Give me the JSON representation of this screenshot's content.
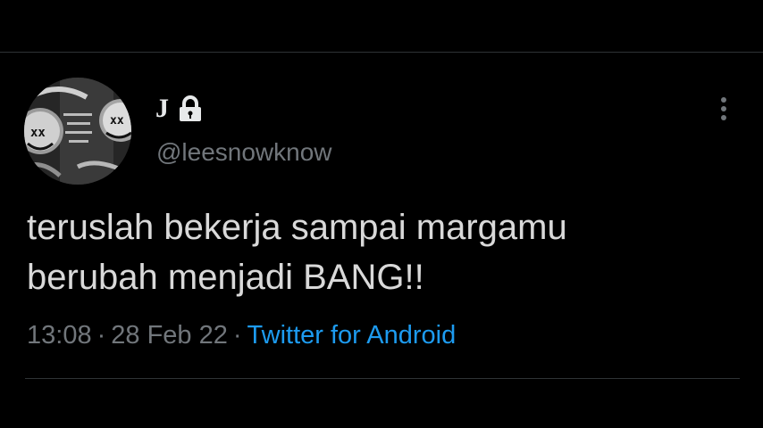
{
  "tweet": {
    "author": {
      "display_name": "J",
      "handle": "@leesnowknow",
      "protected_icon": "lock-icon",
      "avatar_icon": "avatar-image"
    },
    "menu_icon": "more-vertical-icon",
    "text_lines": [
      "teruslah bekerja sampai margamu",
      "berubah menjadi BANG!!"
    ],
    "time": "13:08",
    "separator": "·",
    "date": "28 Feb 22",
    "source": "Twitter for Android"
  },
  "colors": {
    "background": "#000000",
    "text": "#d9d9d9",
    "muted": "#71767b",
    "link": "#1d9bf0",
    "divider": "#2f3336"
  }
}
